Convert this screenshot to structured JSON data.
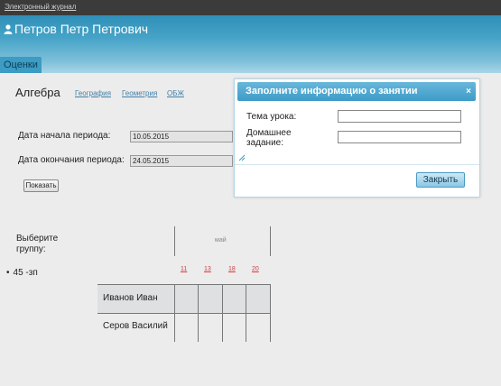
{
  "topbar": {
    "link": "Электронный журнал"
  },
  "header": {
    "user_name": "Петров Петр Петрович",
    "tab": "Оценки"
  },
  "subject": {
    "current": "Алгебра",
    "links": [
      "География",
      "Геометрия",
      "ОБЖ"
    ]
  },
  "period": {
    "start_label": "Дата начала периода:",
    "start_value": "10.05.2015",
    "end_label": "Дата окончания периода:",
    "end_value": "24.05.2015",
    "show_button": "Показать"
  },
  "groups": {
    "label": "Выберите группу:",
    "items": [
      "45 -зп"
    ]
  },
  "grid": {
    "month": "май",
    "days": [
      "11",
      "13",
      "18",
      "20"
    ],
    "students": [
      "Иванов Иван",
      "Серов Василий"
    ]
  },
  "dialog": {
    "title": "Заполните информацию о занятии",
    "close_icon": "×",
    "topic_label": "Тема урока:",
    "homework_label_line1": "Домашнее",
    "homework_label_line2": "задание:",
    "topic_value": "",
    "homework_value": "",
    "close_button": "Закрыть"
  },
  "colors": {
    "header": "#47a4c8",
    "link": "#3f7fa8",
    "day": "#d23c3c"
  }
}
